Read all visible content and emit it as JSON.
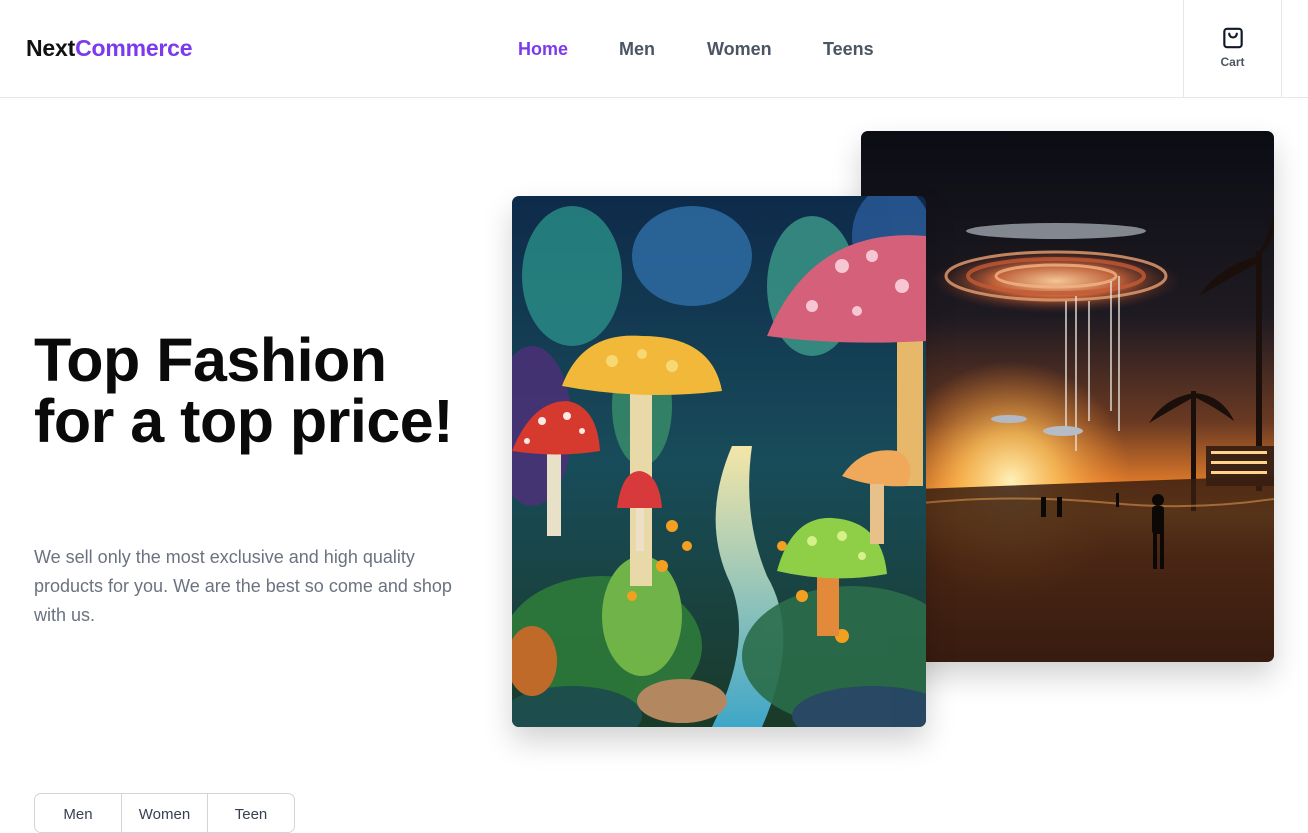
{
  "brand": {
    "part1": "Next",
    "part2": "Commerce",
    "accent_color": "#7c3aed"
  },
  "nav": {
    "items": [
      {
        "label": "Home",
        "active": true
      },
      {
        "label": "Men",
        "active": false
      },
      {
        "label": "Women",
        "active": false
      },
      {
        "label": "Teens",
        "active": false
      }
    ]
  },
  "cart": {
    "label": "Cart",
    "icon": "shopping-bag-icon"
  },
  "hero": {
    "title": "Top Fashion for a top price!",
    "description": "We sell only the most exclusive and high quality products for you. We are the best so come and shop with us.",
    "images": [
      {
        "name": "ufo-beach-image",
        "subject": "UFO over a beach at sunset"
      },
      {
        "name": "mushroom-forest-image",
        "subject": "colorful mushroom forest"
      }
    ]
  },
  "categories": {
    "tabs": [
      {
        "label": "Men"
      },
      {
        "label": "Women"
      },
      {
        "label": "Teen"
      }
    ]
  }
}
